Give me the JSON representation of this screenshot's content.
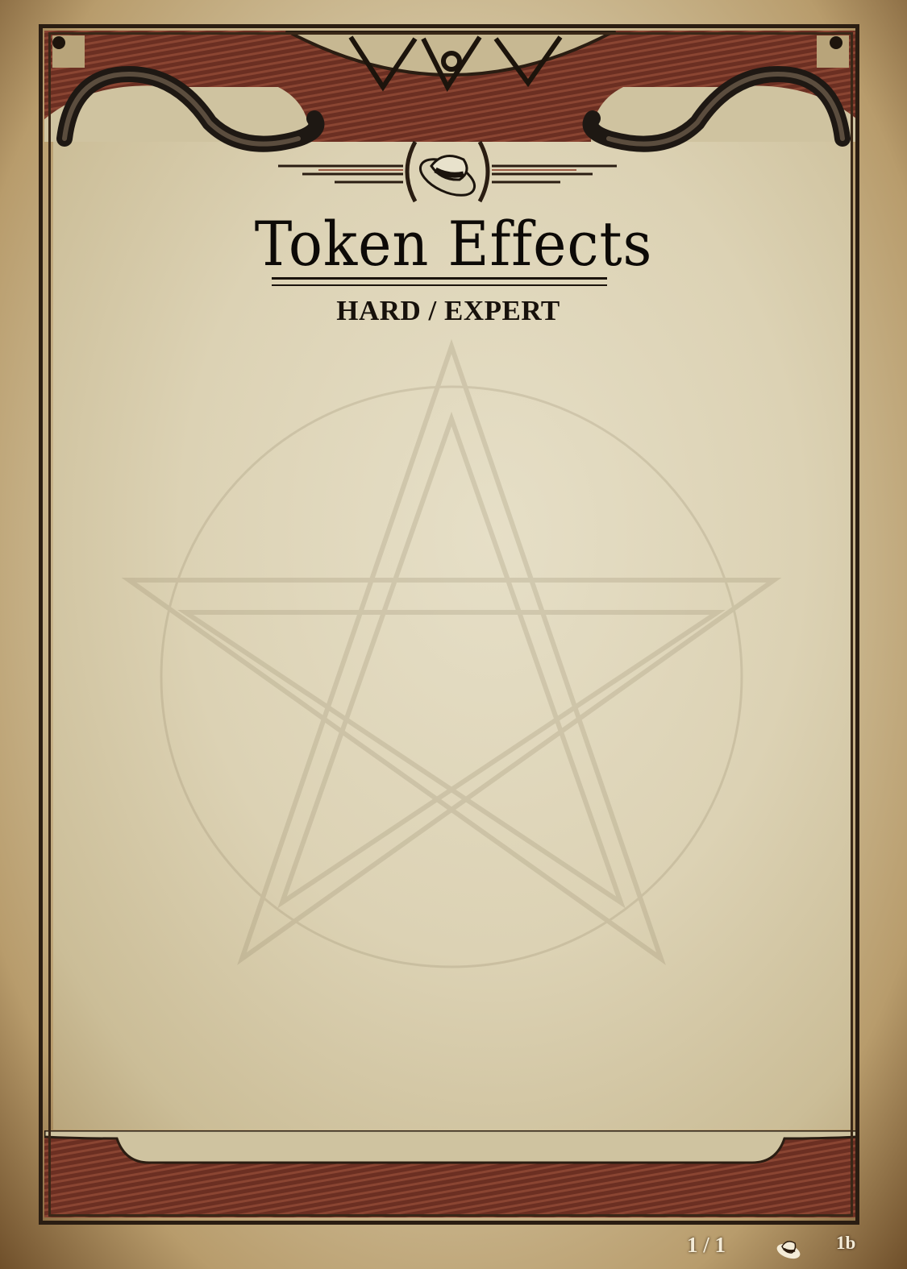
{
  "card": {
    "title": "Token Effects",
    "subtitle": "HARD / EXPERT",
    "body_text": ""
  },
  "footer": {
    "page_count": "1 / 1",
    "set_icon": "fedora-hat-icon",
    "card_code": "1b"
  },
  "colors": {
    "parchment": "#ddd3b5",
    "frame": "#2a1d12",
    "band": "#6b2f22",
    "text": "#0d0a07",
    "footer_text": "#f4ecd8"
  },
  "icons": {
    "header_emblem": "fedora-hat-icon",
    "ornament": "serpent-icon",
    "corner": "corner-stud-icon"
  }
}
